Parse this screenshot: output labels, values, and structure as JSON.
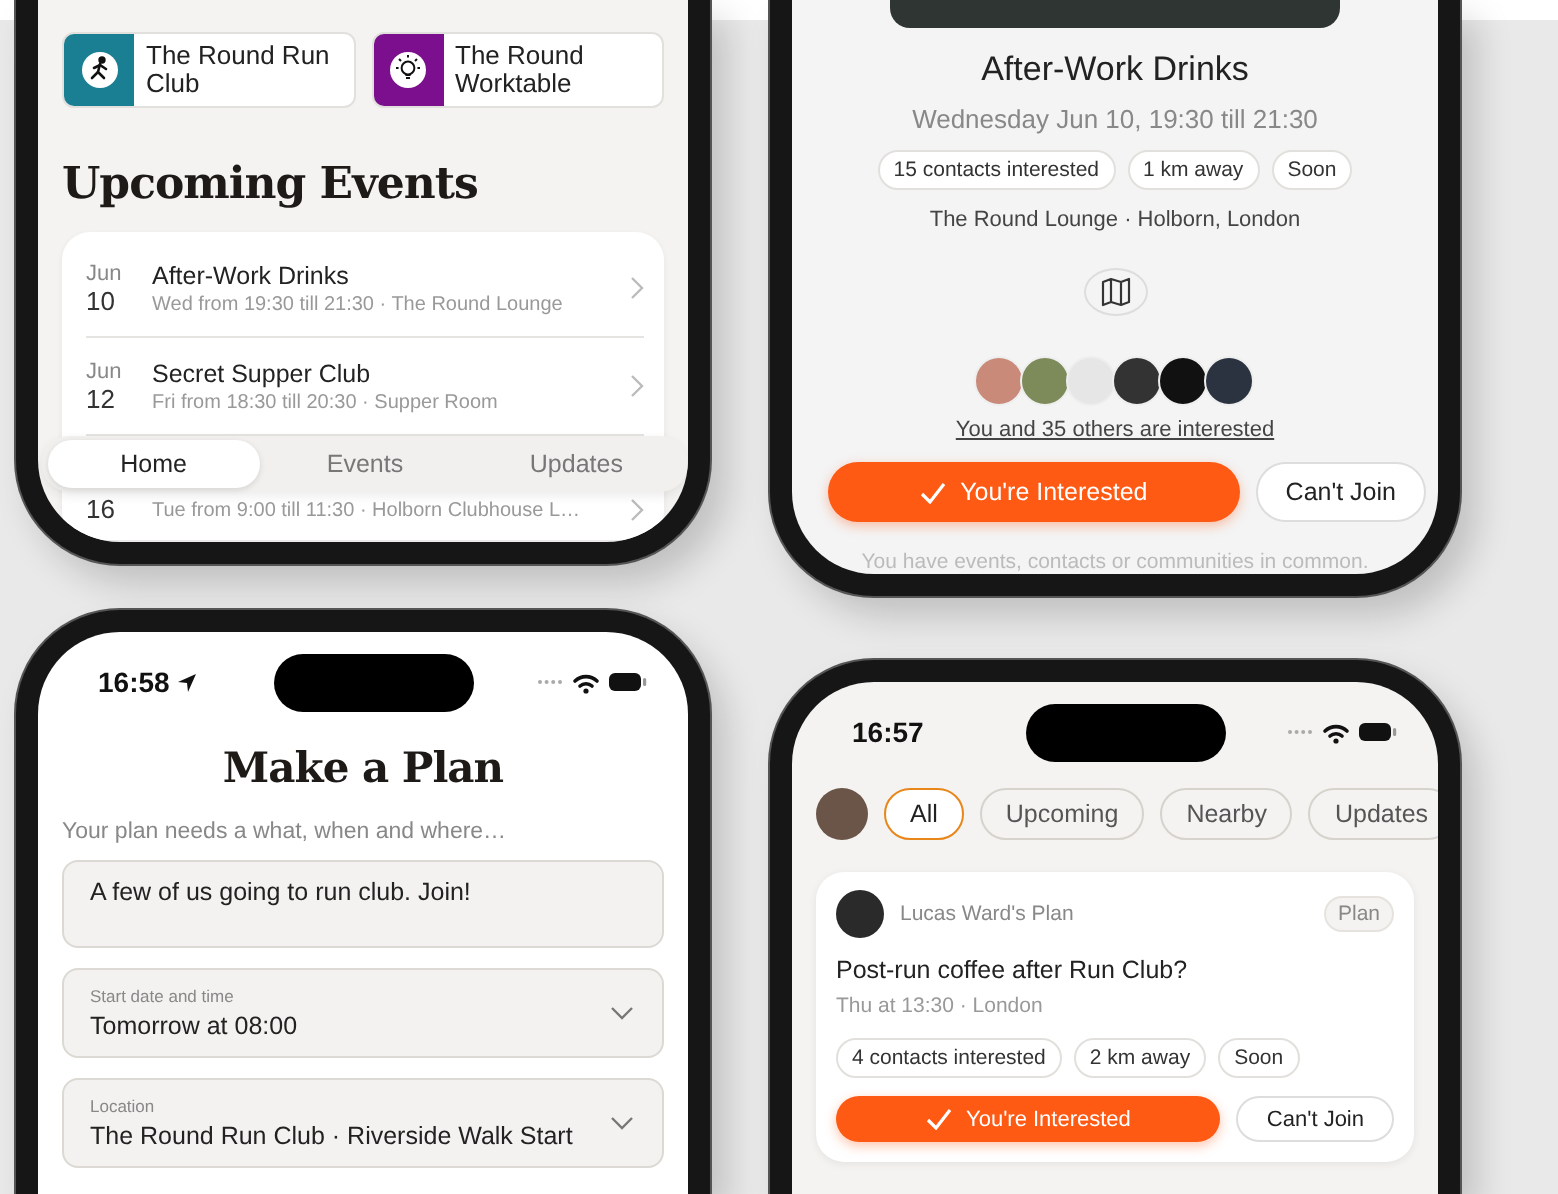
{
  "home_screen": {
    "communities": [
      {
        "name": "The Round Run Club",
        "color": "#1b7f94",
        "kind": "runner"
      },
      {
        "name": "The Round Worktable",
        "color": "#7b0f8e",
        "kind": "idea"
      }
    ],
    "heading": "Upcoming Events",
    "events": [
      {
        "month": "Jun",
        "day": "10",
        "title": "After-Work Drinks",
        "detail": "Wed from 19:30 till 21:30 · The Round Lounge"
      },
      {
        "month": "Jun",
        "day": "12",
        "title": "Secret Supper Club",
        "detail": "Fri from 18:30 till 20:30 · Supper Room"
      },
      {
        "day": "16",
        "detail": "Tue from 9:00 till 11:30 · Holborn Clubhouse L…"
      }
    ],
    "tabs": [
      {
        "label": "Home",
        "selected": true
      },
      {
        "label": "Events",
        "selected": false
      },
      {
        "label": "Updates",
        "selected": false
      }
    ]
  },
  "event_screen": {
    "title": "After-Work Drinks",
    "date": "Wednesday Jun 10, 19:30 till 21:30",
    "chips": [
      "15 contacts interested",
      "1 km away",
      "Soon"
    ],
    "location": "The Round Lounge · Holborn, London",
    "interested": "You and 35 others are interested",
    "buttons": [
      {
        "label": "You're Interested",
        "kind": "primary"
      },
      {
        "label": "Can't Join",
        "kind": "secondary"
      }
    ],
    "section_subtitle": "You have events, contacts or communities in common."
  },
  "plan_screen": {
    "status_bar": {
      "time": "16:58",
      "location_services": true
    },
    "title": "Make a Plan",
    "hint": "Your plan needs a what, when and where…",
    "description": "A few of us going to run club. Join!",
    "fields": [
      {
        "label": "Start date and time",
        "value": "Tomorrow at 08:00"
      },
      {
        "label": "Location",
        "value": "The Round Run Club · Riverside Walk Start"
      }
    ]
  },
  "feed_screen": {
    "status_bar": {
      "time": "16:57",
      "location_services": false
    },
    "filters": [
      {
        "label": "All",
        "selected": true
      },
      {
        "label": "Upcoming",
        "selected": false
      },
      {
        "label": "Nearby",
        "selected": false
      },
      {
        "label": "Updates",
        "selected": false
      }
    ],
    "card": {
      "owner": "Lucas Ward's Plan",
      "badge": "Plan",
      "title": "Post-run coffee after Run Club?",
      "detail": "Thu at 13:30 · London",
      "chips": [
        "4 contacts interested",
        "2 km away",
        "Soon"
      ],
      "buttons": [
        {
          "label": "You're Interested",
          "kind": "primary"
        },
        {
          "label": "Can't Join",
          "kind": "secondary"
        }
      ]
    }
  }
}
